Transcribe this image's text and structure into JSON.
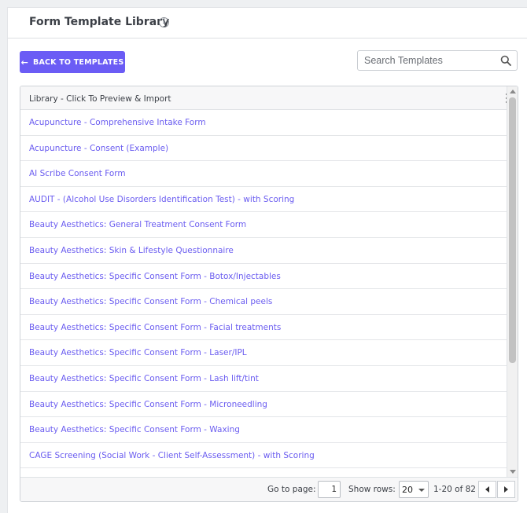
{
  "header": {
    "title": "Form Template Library",
    "info_icon": "info-circle-icon"
  },
  "toolbar": {
    "back_label": "BACK TO TEMPLATES",
    "back_icon": "arrow-left-icon",
    "search_placeholder": "Search Templates",
    "search_value": ""
  },
  "grid": {
    "column_header": "Library - Click To Preview & Import",
    "rows": [
      "Acupuncture - Comprehensive Intake Form",
      "Acupuncture - Consent (Example)",
      "AI Scribe Consent Form",
      "AUDIT - (Alcohol Use Disorders Identification Test) - with Scoring",
      "Beauty Aesthetics: General Treatment Consent Form",
      "Beauty Aesthetics: Skin & Lifestyle Questionnaire",
      "Beauty Aesthetics: Specific Consent Form - Botox/Injectables",
      "Beauty Aesthetics: Specific Consent Form - Chemical peels",
      "Beauty Aesthetics: Specific Consent Form - Facial treatments",
      "Beauty Aesthetics: Specific Consent Form - Laser/IPL",
      "Beauty Aesthetics: Specific Consent Form - Lash lift/tint",
      "Beauty Aesthetics: Specific Consent Form - Microneedling",
      "Beauty Aesthetics: Specific Consent Form - Waxing",
      "CAGE Screening (Social Work - Client Self-Assessment) - with Scoring"
    ]
  },
  "pagination": {
    "go_to_page_label": "Go to page:",
    "page_value": "1",
    "show_rows_label": "Show rows:",
    "rows_value": "20",
    "range_text": "1-20 of 82"
  },
  "colors": {
    "accent": "#6b5cf5",
    "link": "#6a5cf0"
  }
}
